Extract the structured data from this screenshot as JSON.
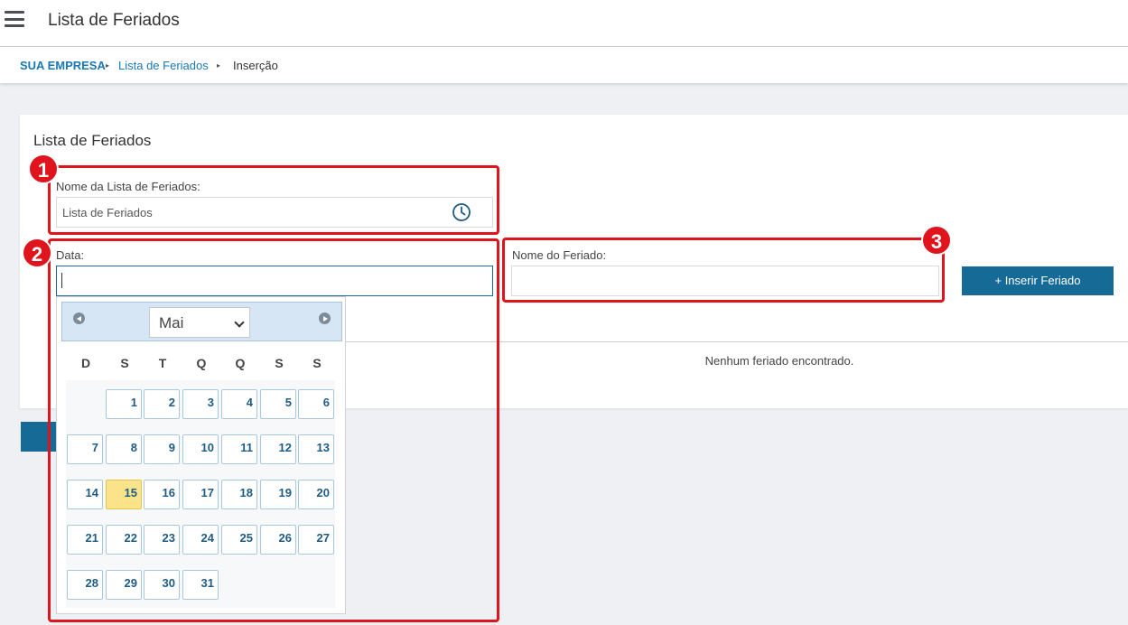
{
  "app": {
    "title": "Lista de Feriados"
  },
  "breadcrumb": {
    "root": "SUA EMPRESA",
    "list": "Lista de Feriados",
    "current": "Inserção",
    "separator": "▸"
  },
  "card": {
    "title": "Lista de Feriados",
    "name_label": "Nome da Lista de Feriados:",
    "name_value": "Lista de Feriados",
    "date_label": "Data:",
    "date_value": "",
    "holiday_label": "Nome do Feriado:",
    "holiday_value": "",
    "insert_button": "+ Inserir Feriado",
    "empty_message": "Nenhum feriado encontrado."
  },
  "datepicker": {
    "month": "Mai",
    "weekdays": [
      "D",
      "S",
      "T",
      "Q",
      "Q",
      "S",
      "S"
    ],
    "first_weekday_index": 1,
    "days_in_month": 31,
    "today": 15
  },
  "annotations": [
    "1",
    "2",
    "3"
  ],
  "colors": {
    "accent": "#156a96",
    "link": "#1a78b4",
    "annotation": "#e0141c",
    "today": "#fbe38a"
  }
}
